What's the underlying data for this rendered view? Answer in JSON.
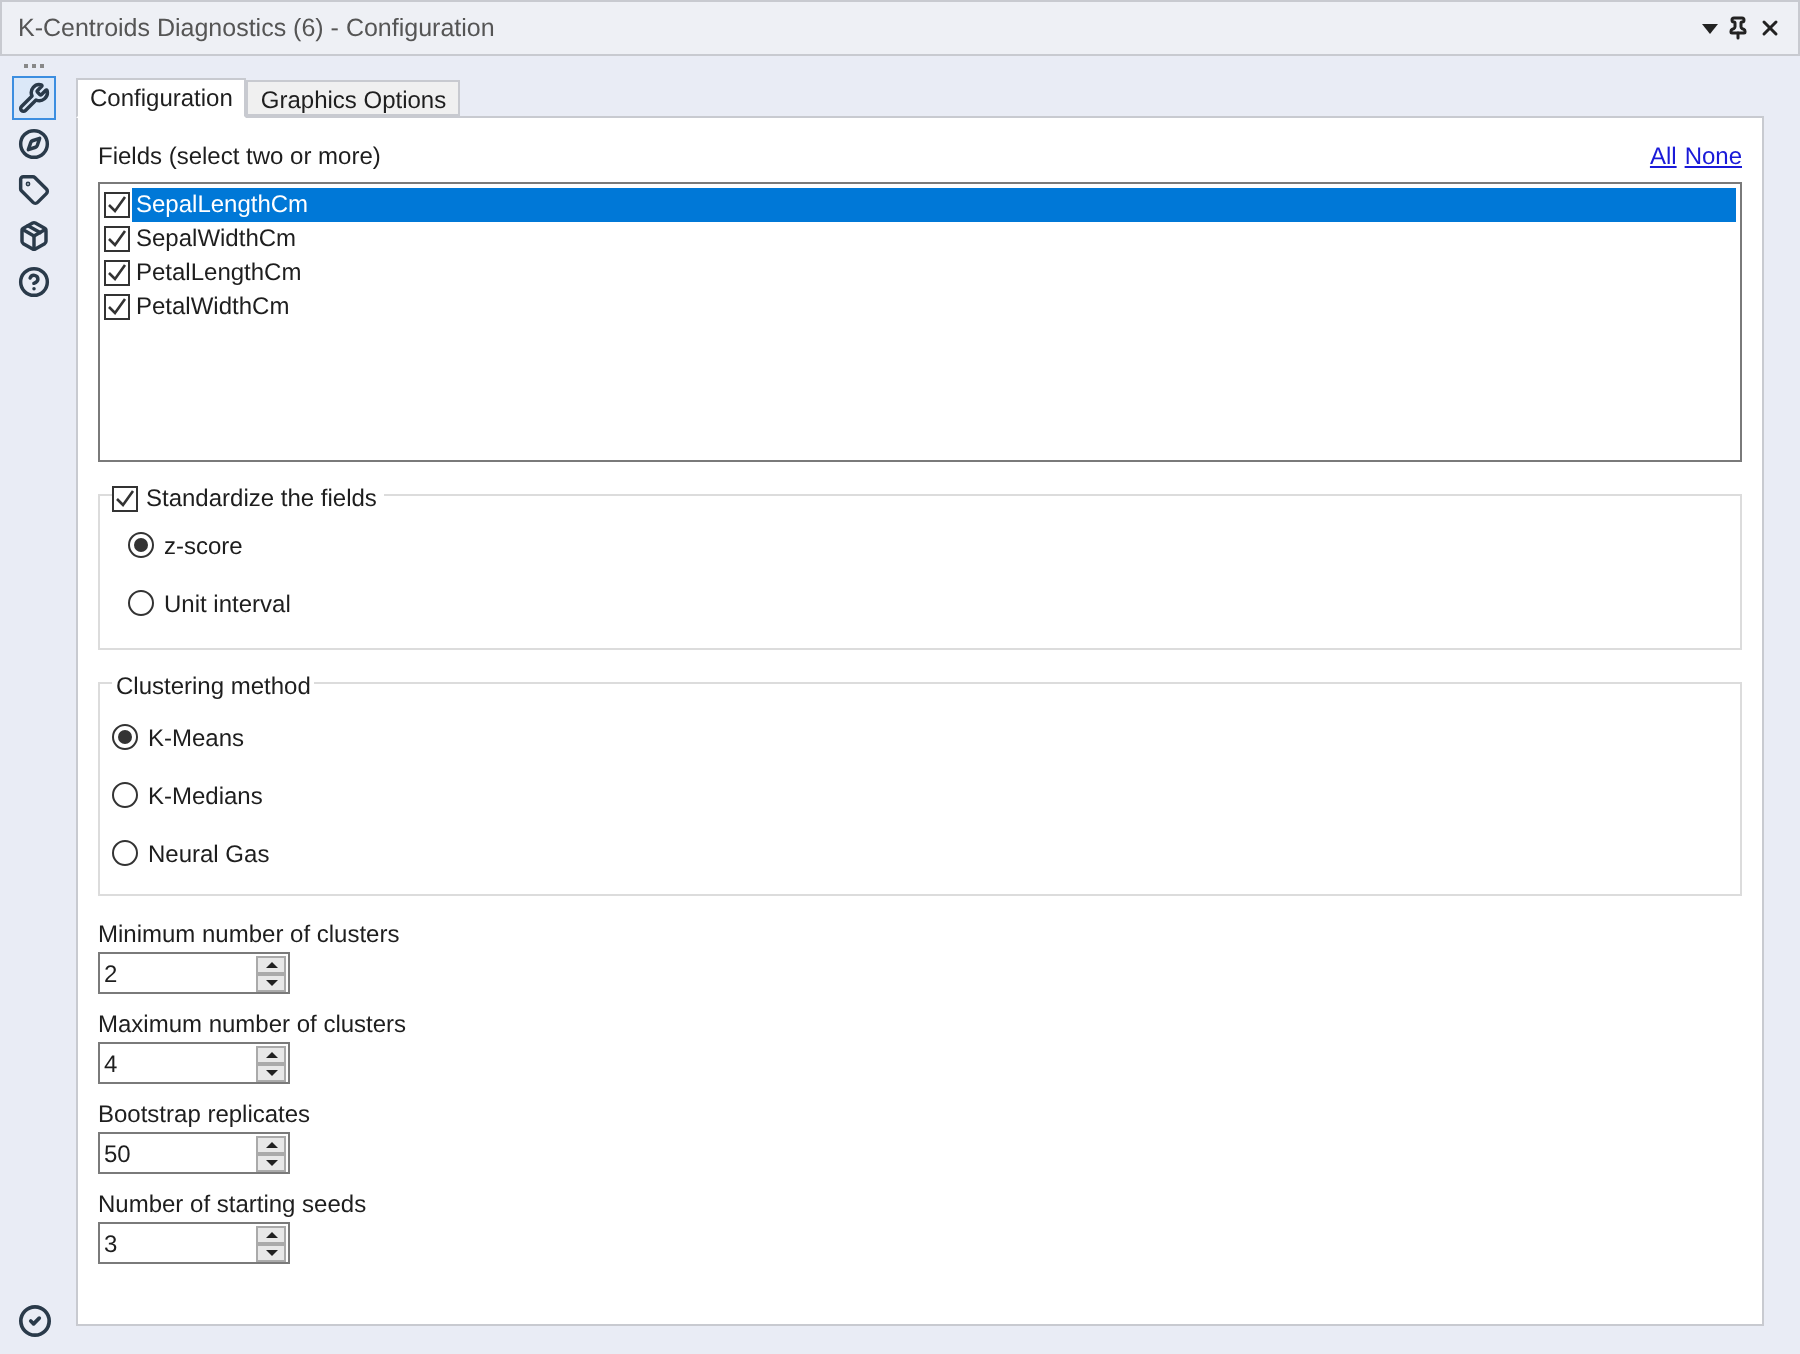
{
  "window": {
    "title": "K-Centroids Diagnostics (6) - Configuration"
  },
  "sidebar": {
    "items": [
      {
        "kind": "wrench",
        "selected": true
      },
      {
        "kind": "compass",
        "selected": false
      },
      {
        "kind": "tag",
        "selected": false
      },
      {
        "kind": "box",
        "selected": false
      },
      {
        "kind": "help",
        "selected": false
      }
    ]
  },
  "tabs": [
    {
      "label": "Configuration",
      "selected": true
    },
    {
      "label": "Graphics Options",
      "selected": false
    }
  ],
  "fields": {
    "label": "Fields (select two or more)",
    "links": [
      "All",
      "None"
    ],
    "items": [
      {
        "label": "SepalLengthCm",
        "checked": true,
        "selected": true
      },
      {
        "label": "SepalWidthCm",
        "checked": true,
        "selected": false
      },
      {
        "label": "PetalLengthCm",
        "checked": true,
        "selected": false
      },
      {
        "label": "PetalWidthCm",
        "checked": true,
        "selected": false
      }
    ]
  },
  "standardize": {
    "label": "Standardize the fields",
    "checked": true,
    "options": [
      {
        "label": "z-score",
        "selected": true
      },
      {
        "label": "Unit interval",
        "selected": false
      }
    ]
  },
  "clustering": {
    "title": "Clustering method",
    "options": [
      {
        "label": "K-Means",
        "selected": true
      },
      {
        "label": "K-Medians",
        "selected": false
      },
      {
        "label": "Neural Gas",
        "selected": false
      }
    ]
  },
  "spinners": [
    {
      "label": "Minimum number of clusters",
      "value": "2"
    },
    {
      "label": "Maximum number of clusters",
      "value": "4"
    },
    {
      "label": "Bootstrap replicates",
      "value": "50"
    },
    {
      "label": "Number of starting seeds",
      "value": "3"
    }
  ]
}
